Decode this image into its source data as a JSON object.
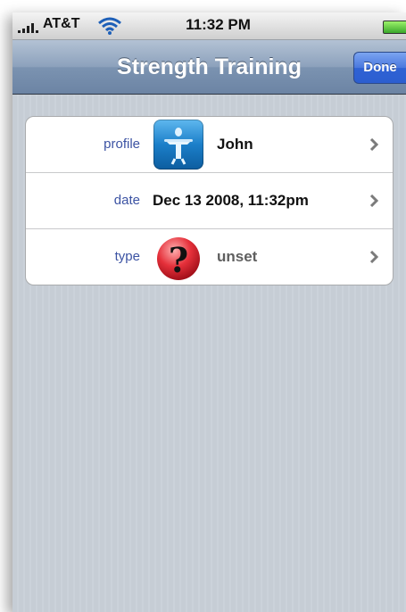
{
  "status_bar": {
    "carrier": "AT&T",
    "time": "11:32 PM"
  },
  "nav": {
    "title": "Strength Training",
    "done_label": "Done"
  },
  "rows": [
    {
      "label": "profile",
      "value": "John"
    },
    {
      "label": "date",
      "value": "Dec 13 2008, 11:32pm"
    },
    {
      "label": "type",
      "value": "unset"
    }
  ],
  "colors": {
    "nav_bar": "#8ca1bc",
    "done_button": "#3b6bdb",
    "row_label": "#3c53a3",
    "background_stripes": "#c5ccd4"
  },
  "icons": {
    "profile": "fitness-person-icon",
    "type": "question-mark-icon"
  }
}
